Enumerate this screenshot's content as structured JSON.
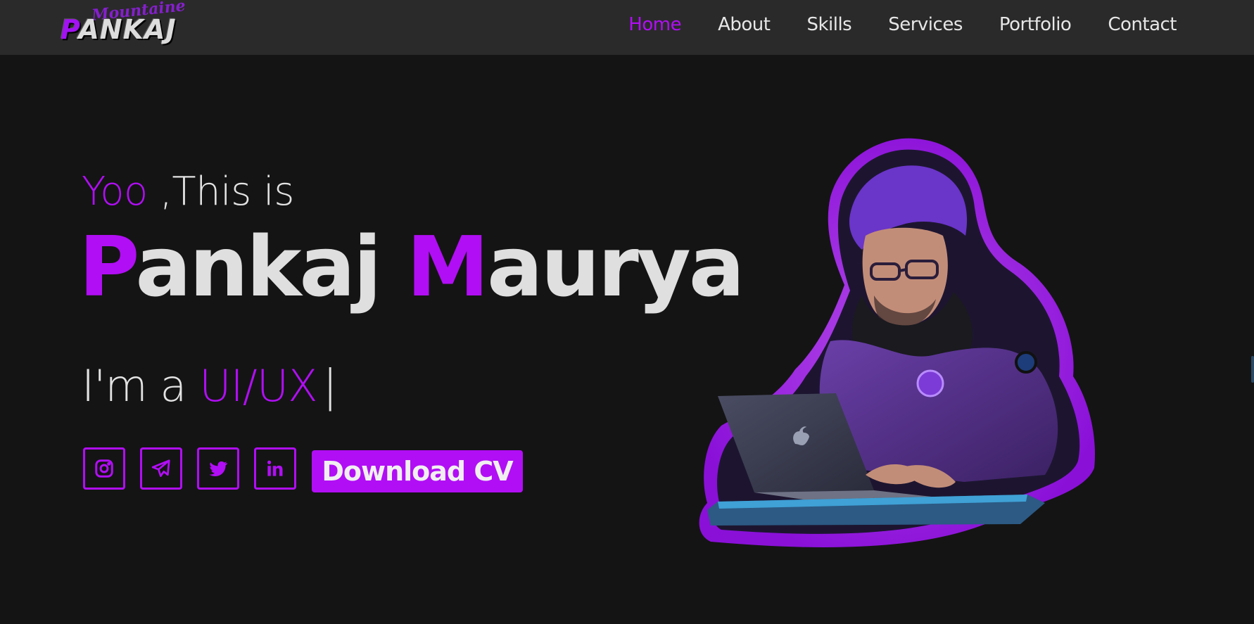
{
  "brand": {
    "script_text": "Mountaine",
    "logo_text": "PANKAJ",
    "logo_first": "P",
    "logo_rest": "ANKAJ"
  },
  "nav": {
    "items": [
      {
        "label": "Home",
        "active": true
      },
      {
        "label": "About"
      },
      {
        "label": "Skills"
      },
      {
        "label": "Services"
      },
      {
        "label": "Portfolio"
      },
      {
        "label": "Contact"
      }
    ]
  },
  "hero": {
    "greeting_accent": "Yoo",
    "greeting_rest": " ,This is",
    "name_first_initial": "P",
    "name_first_rest": "ankaj",
    "name_last_initial": "M",
    "name_last_rest": "aurya",
    "role_prefix": "I'm a ",
    "role_accent": "UI/UX",
    "role_cursor": "|",
    "cv_button": "Download CV"
  },
  "socials": [
    {
      "icon": "instagram-icon"
    },
    {
      "icon": "telegram-icon"
    },
    {
      "icon": "twitter-icon"
    },
    {
      "icon": "linkedin-icon"
    }
  ],
  "colors": {
    "accent": "#b10ef5",
    "background": "#141414",
    "navbar": "#2a2a2a",
    "text": "#dfdfdf"
  }
}
